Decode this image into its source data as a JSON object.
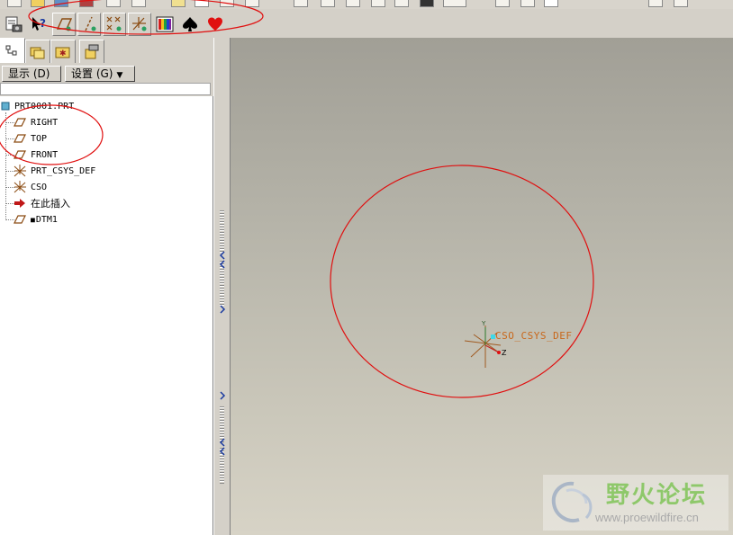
{
  "tabs": [
    {
      "name": "model-tree-icon"
    },
    {
      "name": "folder-browser-icon"
    },
    {
      "name": "favorites-icon"
    },
    {
      "name": "connections-icon"
    }
  ],
  "nav": {
    "show_label": "显示 (D)",
    "settings_label": "设置 (G)"
  },
  "tree": {
    "root": "PRT0001.PRT",
    "items": [
      {
        "label": "RIGHT",
        "icon": "datum-plane-icon"
      },
      {
        "label": "TOP",
        "icon": "datum-plane-icon"
      },
      {
        "label": "FRONT",
        "icon": "datum-plane-icon"
      },
      {
        "label": "PRT_CSYS_DEF",
        "icon": "coordinate-system-icon"
      },
      {
        "label": "CSO",
        "icon": "coordinate-system-icon"
      },
      {
        "label": "在此插入",
        "icon": "insert-here-arrow-icon"
      },
      {
        "label": "DTM1",
        "icon": "datum-plane-icon"
      }
    ]
  },
  "canvas": {
    "csys_label": "CSO_CSYS_DEF",
    "axis_y": "Y",
    "axis_z": "Z",
    "annotation_color": "#e01010"
  },
  "watermark": {
    "title": "野火论坛",
    "url": "www.proewildfire.cn"
  },
  "colors": {
    "canvas_top": "#a19f96",
    "canvas_bottom": "#d7d3c6",
    "label": "#c8681c"
  }
}
